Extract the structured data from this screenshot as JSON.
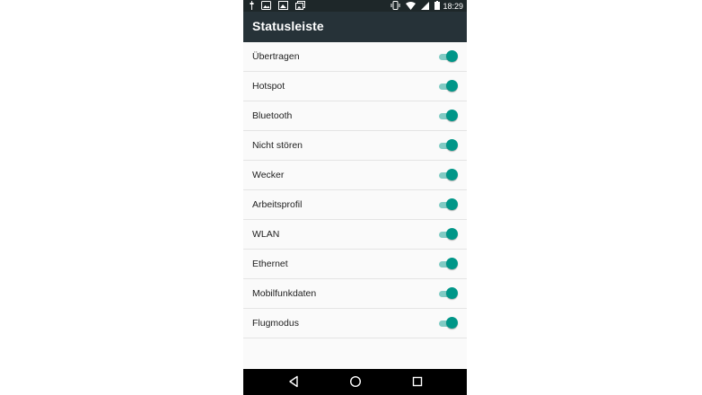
{
  "status_bar": {
    "time": "18:29",
    "left_icons": [
      "usb-icon",
      "photo-notification-icon",
      "image-notification-icon",
      "gallery-notification-icon"
    ],
    "right_icons": [
      "vibrate-icon",
      "wifi-icon",
      "signal-icon",
      "battery-icon"
    ]
  },
  "app_bar": {
    "title": "Statusleiste",
    "background": "#263238"
  },
  "toggles": [
    {
      "label": "Übertragen",
      "on": true
    },
    {
      "label": "Hotspot",
      "on": true
    },
    {
      "label": "Bluetooth",
      "on": true
    },
    {
      "label": "Nicht stören",
      "on": true
    },
    {
      "label": "Wecker",
      "on": true
    },
    {
      "label": "Arbeitsprofil",
      "on": true
    },
    {
      "label": "WLAN",
      "on": true
    },
    {
      "label": "Ethernet",
      "on": true
    },
    {
      "label": "Mobilfunkdaten",
      "on": true
    },
    {
      "label": "Flugmodus",
      "on": true
    }
  ],
  "accent_color": "#009688",
  "nav_bar": {
    "buttons": [
      "back-icon",
      "home-icon",
      "recents-icon"
    ]
  }
}
